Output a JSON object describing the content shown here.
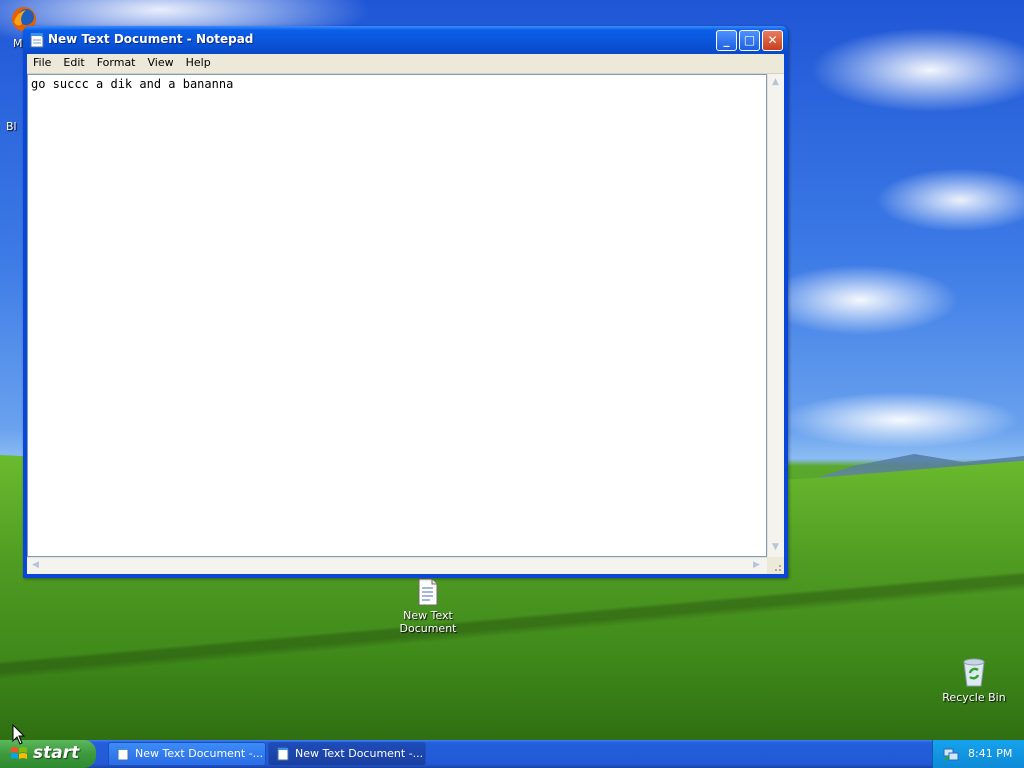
{
  "desktop": {
    "icons": [
      {
        "label": "Moz"
      },
      {
        "label": "Bl"
      },
      {
        "label": "New Text Document",
        "line1": "New Text",
        "line2": "Document"
      },
      {
        "label": "Recycle Bin"
      }
    ]
  },
  "window": {
    "title": "New Text Document - Notepad",
    "buttons": {
      "minimize": "_",
      "maximize": "□",
      "close": "✕"
    },
    "menu": [
      "File",
      "Edit",
      "Format",
      "View",
      "Help"
    ],
    "content": "go succc a dik and a bananna"
  },
  "taskbar": {
    "start_label": "start",
    "tasks": [
      {
        "label": "New Text Document -...",
        "active": false
      },
      {
        "label": "New Text Document -...",
        "active": true
      }
    ],
    "clock": "8:41 PM"
  },
  "icons": {
    "app": "notepad-icon",
    "recycle": "recycle-bin-icon",
    "file": "text-document-icon",
    "network": "network-icon",
    "start": "windows-flag-icon"
  },
  "colors": {
    "title_bar": "#0a54d8",
    "taskbar": "#245edb",
    "start_button": "#3c9a3c",
    "tray": "#0e8ad6",
    "menu_bg": "#ece9d8"
  }
}
